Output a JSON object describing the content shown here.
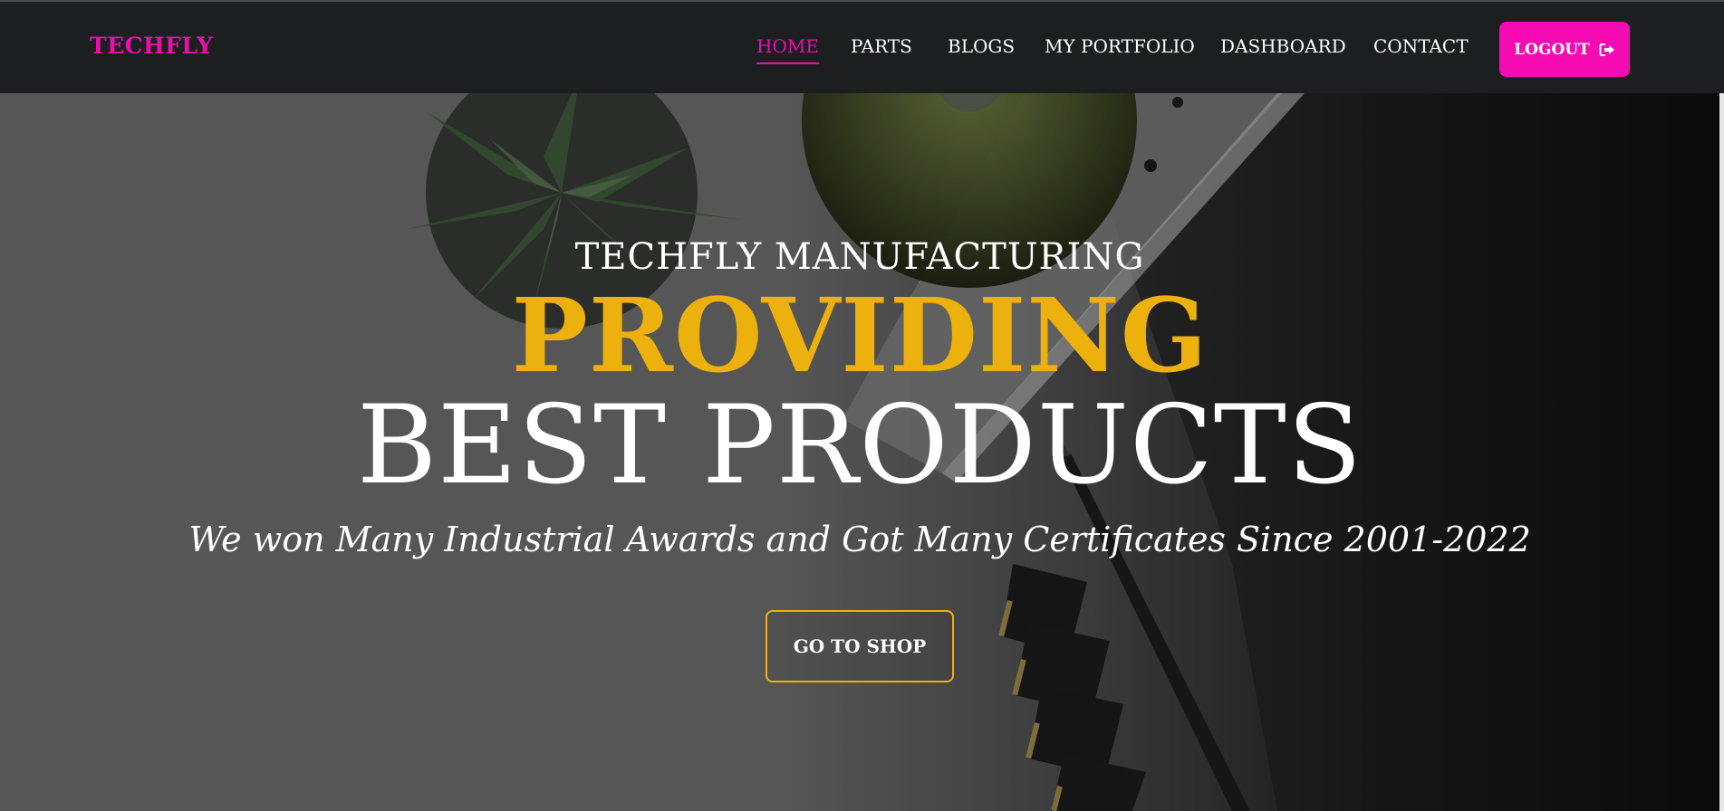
{
  "brand": {
    "name": "TECHFLY"
  },
  "nav": {
    "items": [
      {
        "label": "HOME",
        "active": true
      },
      {
        "label": "PARTS",
        "active": false
      },
      {
        "label": "BLOGS",
        "active": false
      },
      {
        "label": "MY PORTFOLIO",
        "active": false
      },
      {
        "label": "DASHBOARD",
        "active": false
      },
      {
        "label": "CONTACT",
        "active": false
      }
    ],
    "logout_label": "LOGOUT",
    "logout_icon": "sign-out-icon"
  },
  "hero": {
    "eyebrow": "TECHFLY MANUFACTURING",
    "highlight": "PROVIDING",
    "title": "BEST PRODUCTS",
    "subtitle": "We won Many Industrial Awards and Got Many Certificates Since 2001-2022",
    "cta_label": "GO TO SHOP"
  },
  "colors": {
    "accent_pink": "#ec0eab",
    "accent_gold": "#ecb10c",
    "navbar_bg": "#1c1e20"
  }
}
